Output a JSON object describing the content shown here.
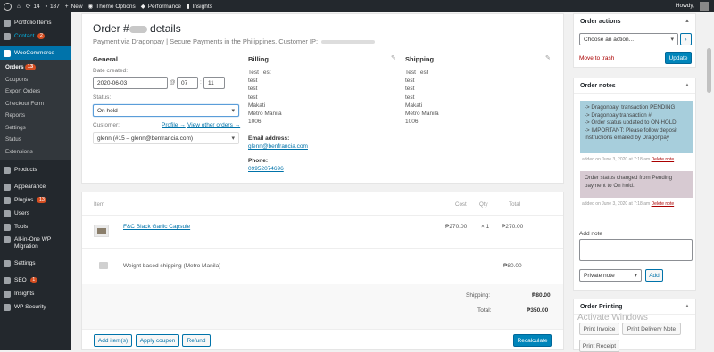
{
  "adminbar": {
    "site_count": "14",
    "comments": "187",
    "new": "New",
    "theme_options": "Theme Options",
    "performance": "Performance",
    "insights": "Insights",
    "howdy": "Howdy,"
  },
  "sidebar": {
    "portfolio": "Portfolio Items",
    "contact": "Contact",
    "contact_badge": "2",
    "woocommerce": "WooCommerce",
    "sub": [
      "Orders",
      "Coupons",
      "Export Orders",
      "Checkout Form",
      "Reports",
      "Settings",
      "Status",
      "Extensions"
    ],
    "orders_badge": "13",
    "products": "Products",
    "appearance": "Appearance",
    "plugins": "Plugins",
    "plugins_badge": "13",
    "users": "Users",
    "tools": "Tools",
    "migration": "All-in-One WP Migration",
    "settings": "Settings",
    "seo": "SEO",
    "seo_badge": "1",
    "insights": "Insights",
    "wp_security": "WP Security"
  },
  "order": {
    "title_prefix": "Order #",
    "title_suffix": "details",
    "payment_line": "Payment via Dragonpay | Secure Payments in the Philippines. Customer IP:",
    "general": {
      "title": "General",
      "date_label": "Date created:",
      "date_value": "2020-06-03",
      "at": "@",
      "hour": "07",
      "minute": "11",
      "status_label": "Status:",
      "status_value": "On hold",
      "customer_label": "Customer:",
      "profile_link": "Profile →",
      "other_orders_link": "View other orders →",
      "customer_value": "glenn (#15 – glenn@benfrancia.com)"
    },
    "billing": {
      "title": "Billing",
      "address": "Test Test\ntest\ntest\ntest\nMakati\nMetro Manila\n1006",
      "email_label": "Email address:",
      "email": "glenn@benfrancia.com",
      "phone_label": "Phone:",
      "phone": "09952074696"
    },
    "shipping": {
      "title": "Shipping",
      "address": "Test Test\ntest\ntest\ntest\nMakati\nMetro Manila\n1006"
    }
  },
  "items": {
    "headers": {
      "item": "Item",
      "cost": "Cost",
      "qty": "Qty",
      "total": "Total"
    },
    "line": {
      "name": "F&C Black Garlic Capsule",
      "cost": "₱270.00",
      "qty": "× 1",
      "total": "₱270.00"
    },
    "shipping": {
      "name": "Weight based shipping (Metro Manila)",
      "total": "₱80.00"
    },
    "shipping_label": "Shipping:",
    "shipping_total": "₱80.00",
    "total_label": "Total:",
    "total_value": "₱350.00",
    "buttons": {
      "add_items": "Add item(s)",
      "apply_coupon": "Apply coupon",
      "refund": "Refund",
      "recalculate": "Recalculate"
    }
  },
  "actions": {
    "title": "Order actions",
    "select": "Choose an action...",
    "go": "›",
    "trash": "Move to trash",
    "update": "Update"
  },
  "notes": {
    "title": "Order notes",
    "note1": "-> Dragonpay: transaction PENDING\n-> Dragonpay transaction #\n-> Order status updated to ON-HOLD\n-> IMPORTANT: Please follow deposit instructions emailed by Dragonpay",
    "note1_meta": "added on June 3, 2020 at 7:18 am",
    "note2": "Order status changed from Pending payment to On hold.",
    "note2_meta": "added on June 3, 2020 at 7:18 am",
    "delete": "Delete note",
    "add_label": "Add note",
    "type": "Private note",
    "add_btn": "Add"
  },
  "printing": {
    "title": "Order Printing",
    "invoice": "Print Invoice",
    "delivery": "Print Delivery Note",
    "receipt": "Print Receipt"
  },
  "watermark": "Activate Windows"
}
